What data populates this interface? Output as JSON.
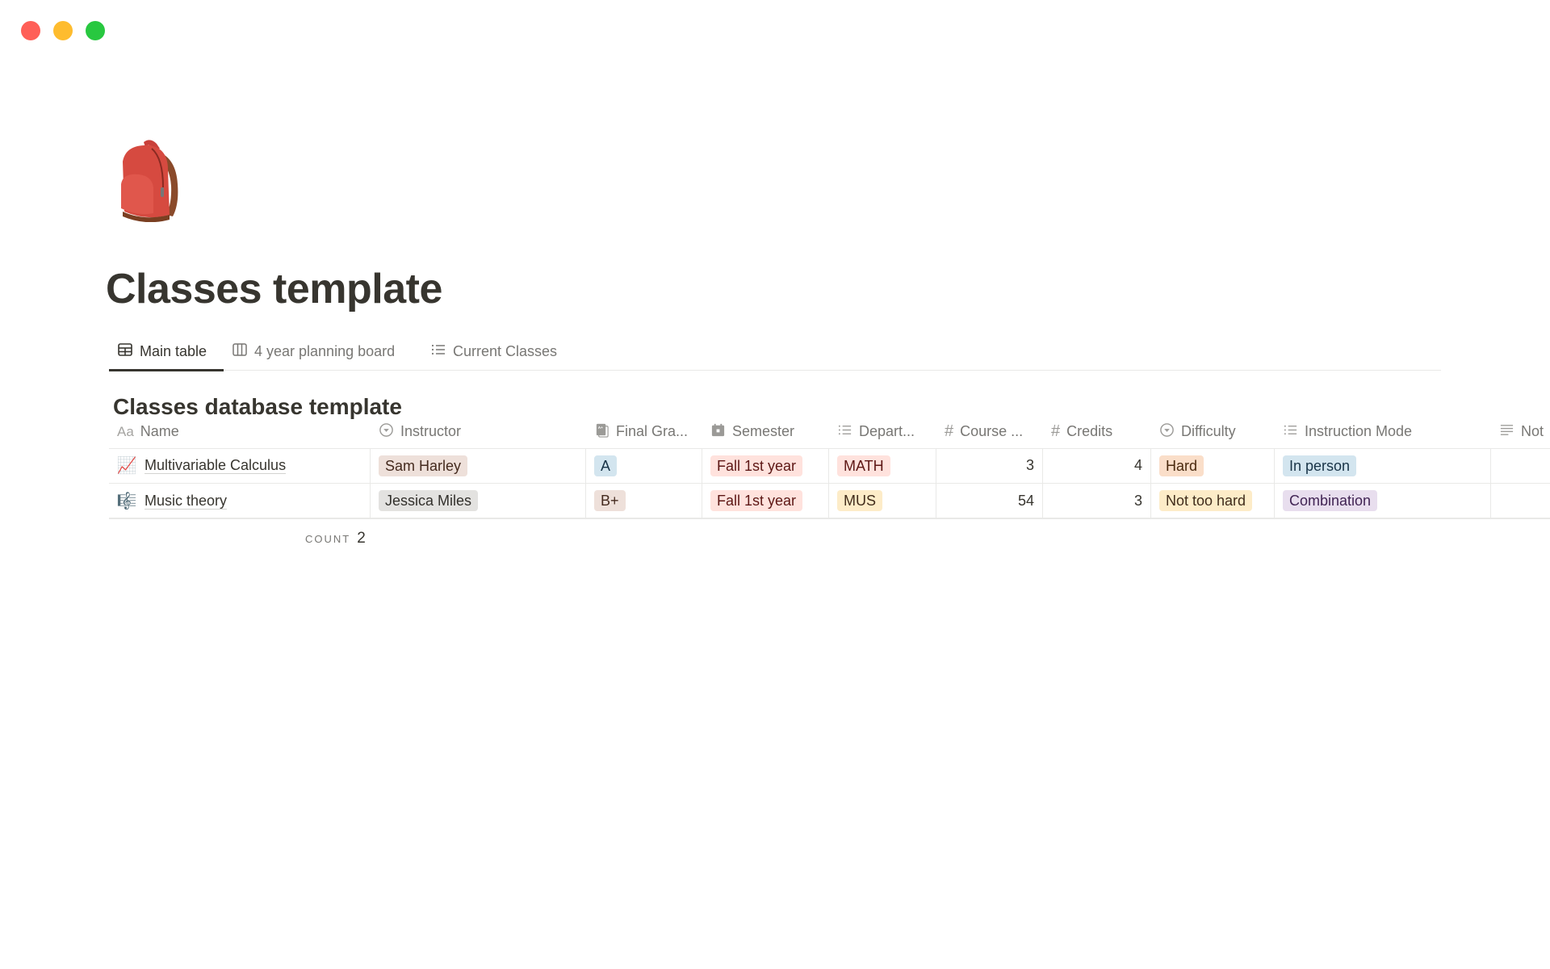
{
  "window": {
    "controls": [
      "close",
      "minimize",
      "maximize"
    ]
  },
  "page": {
    "icon": "backpack-emoji",
    "title": "Classes template"
  },
  "views": [
    {
      "label": "Main table",
      "icon": "table-icon",
      "active": true
    },
    {
      "label": "4 year planning board",
      "icon": "board-icon",
      "active": false
    },
    {
      "label": "Current Classes",
      "icon": "list-icon",
      "active": false
    }
  ],
  "database": {
    "title": "Classes database template",
    "columns": [
      {
        "label": "Name",
        "icon": "title-icon"
      },
      {
        "label": "Instructor",
        "icon": "select-icon"
      },
      {
        "label": "Final Gra...",
        "icon": "grade-icon"
      },
      {
        "label": "Semester",
        "icon": "calendar-icon"
      },
      {
        "label": "Depart...",
        "icon": "multi-select-icon"
      },
      {
        "label": "Course ...",
        "icon": "number-icon"
      },
      {
        "label": "Credits",
        "icon": "number-icon"
      },
      {
        "label": "Difficulty",
        "icon": "select-icon"
      },
      {
        "label": "Instruction Mode",
        "icon": "multi-select-icon"
      },
      {
        "label": "Not",
        "icon": "text-icon"
      }
    ],
    "rows": [
      {
        "emoji": "📈",
        "name": "Multivariable Calculus",
        "instructor": {
          "text": "Sam Harley",
          "bg": "#eee0da",
          "fg": "#442a1e"
        },
        "final_grade": {
          "text": "A",
          "bg": "#d3e5ef",
          "fg": "#183347"
        },
        "semester": {
          "text": "Fall 1st year",
          "bg": "#ffe2dd",
          "fg": "#5d1715"
        },
        "department": {
          "text": "MATH",
          "bg": "#ffe2dd",
          "fg": "#5d1715"
        },
        "course": "3",
        "credits": "4",
        "difficulty": {
          "text": "Hard",
          "bg": "#fadec9",
          "fg": "#49290e"
        },
        "mode": {
          "text": "In person",
          "bg": "#d3e5ef",
          "fg": "#183347"
        },
        "notes": ""
      },
      {
        "emoji": "🎼",
        "name": "Music theory",
        "instructor": {
          "text": "Jessica Miles",
          "bg": "#e3e2e0",
          "fg": "#32302c"
        },
        "final_grade": {
          "text": "B+",
          "bg": "#eee0da",
          "fg": "#442a1e"
        },
        "semester": {
          "text": "Fall 1st year",
          "bg": "#ffe2dd",
          "fg": "#5d1715"
        },
        "department": {
          "text": "MUS",
          "bg": "#fdecc8",
          "fg": "#402c1b"
        },
        "course": "54",
        "credits": "3",
        "difficulty": {
          "text": "Not too hard",
          "bg": "#fdecc8",
          "fg": "#402c1b"
        },
        "mode": {
          "text": "Combination",
          "bg": "#e8deee",
          "fg": "#412454"
        },
        "notes": ""
      }
    ],
    "footer": {
      "count_label": "COUNT",
      "count_value": "2"
    }
  }
}
